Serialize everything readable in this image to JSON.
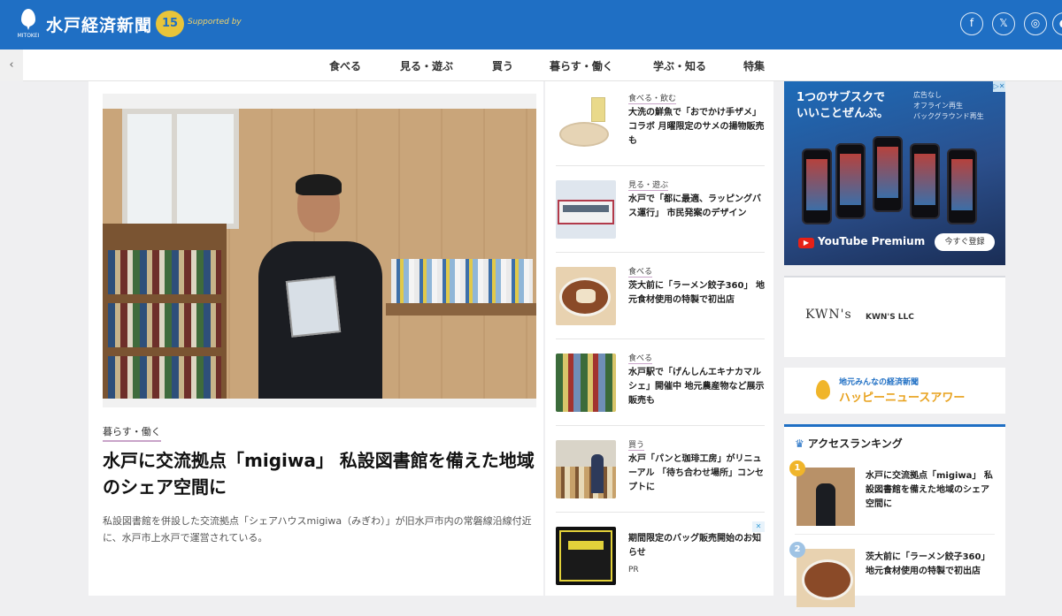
{
  "header": {
    "logo_sub": "MITOKEI",
    "title": "水戸経済新聞",
    "anniversary_badge": "15",
    "anniversary_text": "Supported by"
  },
  "social": [
    {
      "name": "facebook-icon",
      "glyph": "f"
    },
    {
      "name": "x-icon",
      "glyph": "𝕏"
    },
    {
      "name": "instagram-icon",
      "glyph": "◎"
    },
    {
      "name": "more-icon",
      "glyph": "●"
    }
  ],
  "nav": {
    "back_glyph": "‹",
    "items": [
      "食べる",
      "見る・遊ぶ",
      "買う",
      "暮らす・働く",
      "学ぶ・知る",
      "特集"
    ]
  },
  "main": {
    "category": "暮らす・働く",
    "headline": "水戸に交流拠点「migiwa」 私設図書館を備えた地域のシェア空間に",
    "lead": "私設図書館を併設した交流拠点「シェアハウスmigiwa（みぎわ）」が旧水戸市内の常磐線沿線付近に、水戸市上水戸で運営されている。"
  },
  "side_articles": [
    {
      "tag": "食べる・飲む",
      "title": "大洗の鮮魚で「おでかけ手ザメ」コラボ 月曜限定のサメの揚物販売も"
    },
    {
      "tag": "見る・遊ぶ",
      "title": "水戸で「都に最適、ラッピングバス運行」 市民発案のデザイン"
    },
    {
      "tag": "食べる",
      "title": "茨大前に「ラーメン餃子360」 地元食材使用の特製で初出店"
    },
    {
      "tag": "食べる",
      "title": "水戸駅で「げんしんエキナカマルシェ」開催中 地元農産物など展示販売も"
    },
    {
      "tag": "買う",
      "title": "水戸「パンと珈琲工房」がリニューアル 「待ち合わせ場所」コンセプトに"
    },
    {
      "tag": "",
      "title": "期間限定のバッグ販売開始のお知らせ",
      "sub": "PR"
    }
  ],
  "ad_youtube": {
    "copy_line1": "1つのサブスクで",
    "copy_line2": "いいことぜんぶ。",
    "small_line1": "広告なし",
    "small_line2": "オフライン再生",
    "small_line3": "バックグラウンド再生",
    "brand": "YouTube Premium",
    "cta": "今すぐ登録",
    "close": "▷✕"
  },
  "sponsor": {
    "logo": "KWN's",
    "name": "KWN'S LLC"
  },
  "happy": {
    "line1": "地元みんなの経済新聞",
    "line2": "ハッピーニュースアワー"
  },
  "ranking": {
    "heading": "アクセスランキング",
    "items": [
      {
        "num": "1",
        "color": "#f0b52a",
        "title": "水戸に交流拠点「migiwa」 私設図書館を備えた地域のシェア空間に"
      },
      {
        "num": "2",
        "color": "#9fc3e4",
        "title": "茨大前に「ラーメン餃子360」 地元食材使用の特製で初出店"
      }
    ]
  }
}
